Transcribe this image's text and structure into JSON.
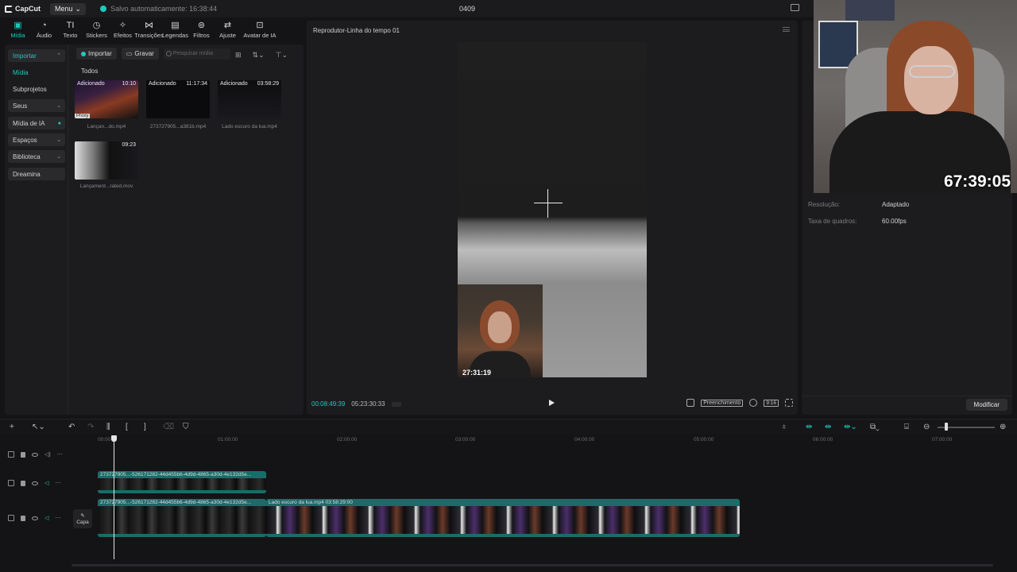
{
  "app": {
    "logo_text": "CapCut",
    "menu_label": "Menu",
    "save_status": "Salvo automaticamente: 16:38:44",
    "project_title": "0409"
  },
  "toolbar": {
    "tabs": [
      {
        "label": "Mídia",
        "icon": "media-icon",
        "active": true
      },
      {
        "label": "Áudio",
        "icon": "audio-icon"
      },
      {
        "label": "Texto",
        "icon": "text-icon"
      },
      {
        "label": "Stickers",
        "icon": "sticker-icon"
      },
      {
        "label": "Efeitos",
        "icon": "effects-icon"
      },
      {
        "label": "Transições",
        "icon": "transitions-icon"
      },
      {
        "label": "Legendas",
        "icon": "captions-icon"
      },
      {
        "label": "Filtros",
        "icon": "filters-icon"
      },
      {
        "label": "Ajuste",
        "icon": "adjust-icon"
      },
      {
        "label": "Avatar de IA",
        "icon": "avatar-icon"
      }
    ]
  },
  "sidebar": {
    "items": [
      {
        "label": "Importar"
      },
      {
        "label": "Mídia"
      },
      {
        "label": "Subprojetos"
      },
      {
        "label": "Seus"
      },
      {
        "label": "Mídia de IA"
      },
      {
        "label": "Espaços"
      },
      {
        "label": "Biblioteca"
      },
      {
        "label": "Dreamina"
      }
    ]
  },
  "media": {
    "import_label": "Importar",
    "record_label": "Gravar",
    "search_placeholder": "Pesquisar mídia",
    "section_label": "Todos",
    "proxy_label": "Proxy",
    "items": [
      {
        "tag": "Adicionado",
        "duration": "10:10",
        "name": "Lançan...do.mp4"
      },
      {
        "tag": "Adicionado",
        "duration": "11:17:34",
        "name": "273727905...a381b.mp4"
      },
      {
        "tag": "Adicionado",
        "duration": "03:58:29",
        "name": "Lado escuro da lua.mp4"
      },
      {
        "tag": "",
        "duration": "09:23",
        "name": "Lançament...rated.mov"
      }
    ]
  },
  "player": {
    "title": "Reprodutor-Linha do tempo 01",
    "current_time": "00:08:49:39",
    "total_time": "05:23:30:33",
    "fill_label": "Preenchimento",
    "ratio_label": "9:16",
    "pip_time": "27:31:19"
  },
  "details": {
    "rows": [
      {
        "label": "Resolução:",
        "value": "Adaptado"
      },
      {
        "label": "Taxa de quadros:",
        "value": "60.00fps"
      }
    ],
    "modify_label": "Modificar"
  },
  "webcam": {
    "timer": "67:39:05"
  },
  "timeline": {
    "ruler": [
      "00:00",
      "01:00:00",
      "02:00:00",
      "03:00:00",
      "04:00:00",
      "05:00:00",
      "06:00:00",
      "07:00:00"
    ],
    "cover_label": "Capa",
    "clips": [
      {
        "title": "273727905...-526171282-44d455b6-4d9d-4865-a30d-4e132d5e...",
        "track": 1
      },
      {
        "title": "273727905...-526171282-44d455b6-4d9d-4865-a30d-4e132d5e...",
        "track": 2
      },
      {
        "title": "Lado escuro da lua.mp4   03:58:29:00",
        "track": 2
      }
    ]
  },
  "colors": {
    "accent": "#1fc9bd",
    "clip_header": "#1a6c68",
    "panel_bg": "#1c1c1f"
  }
}
